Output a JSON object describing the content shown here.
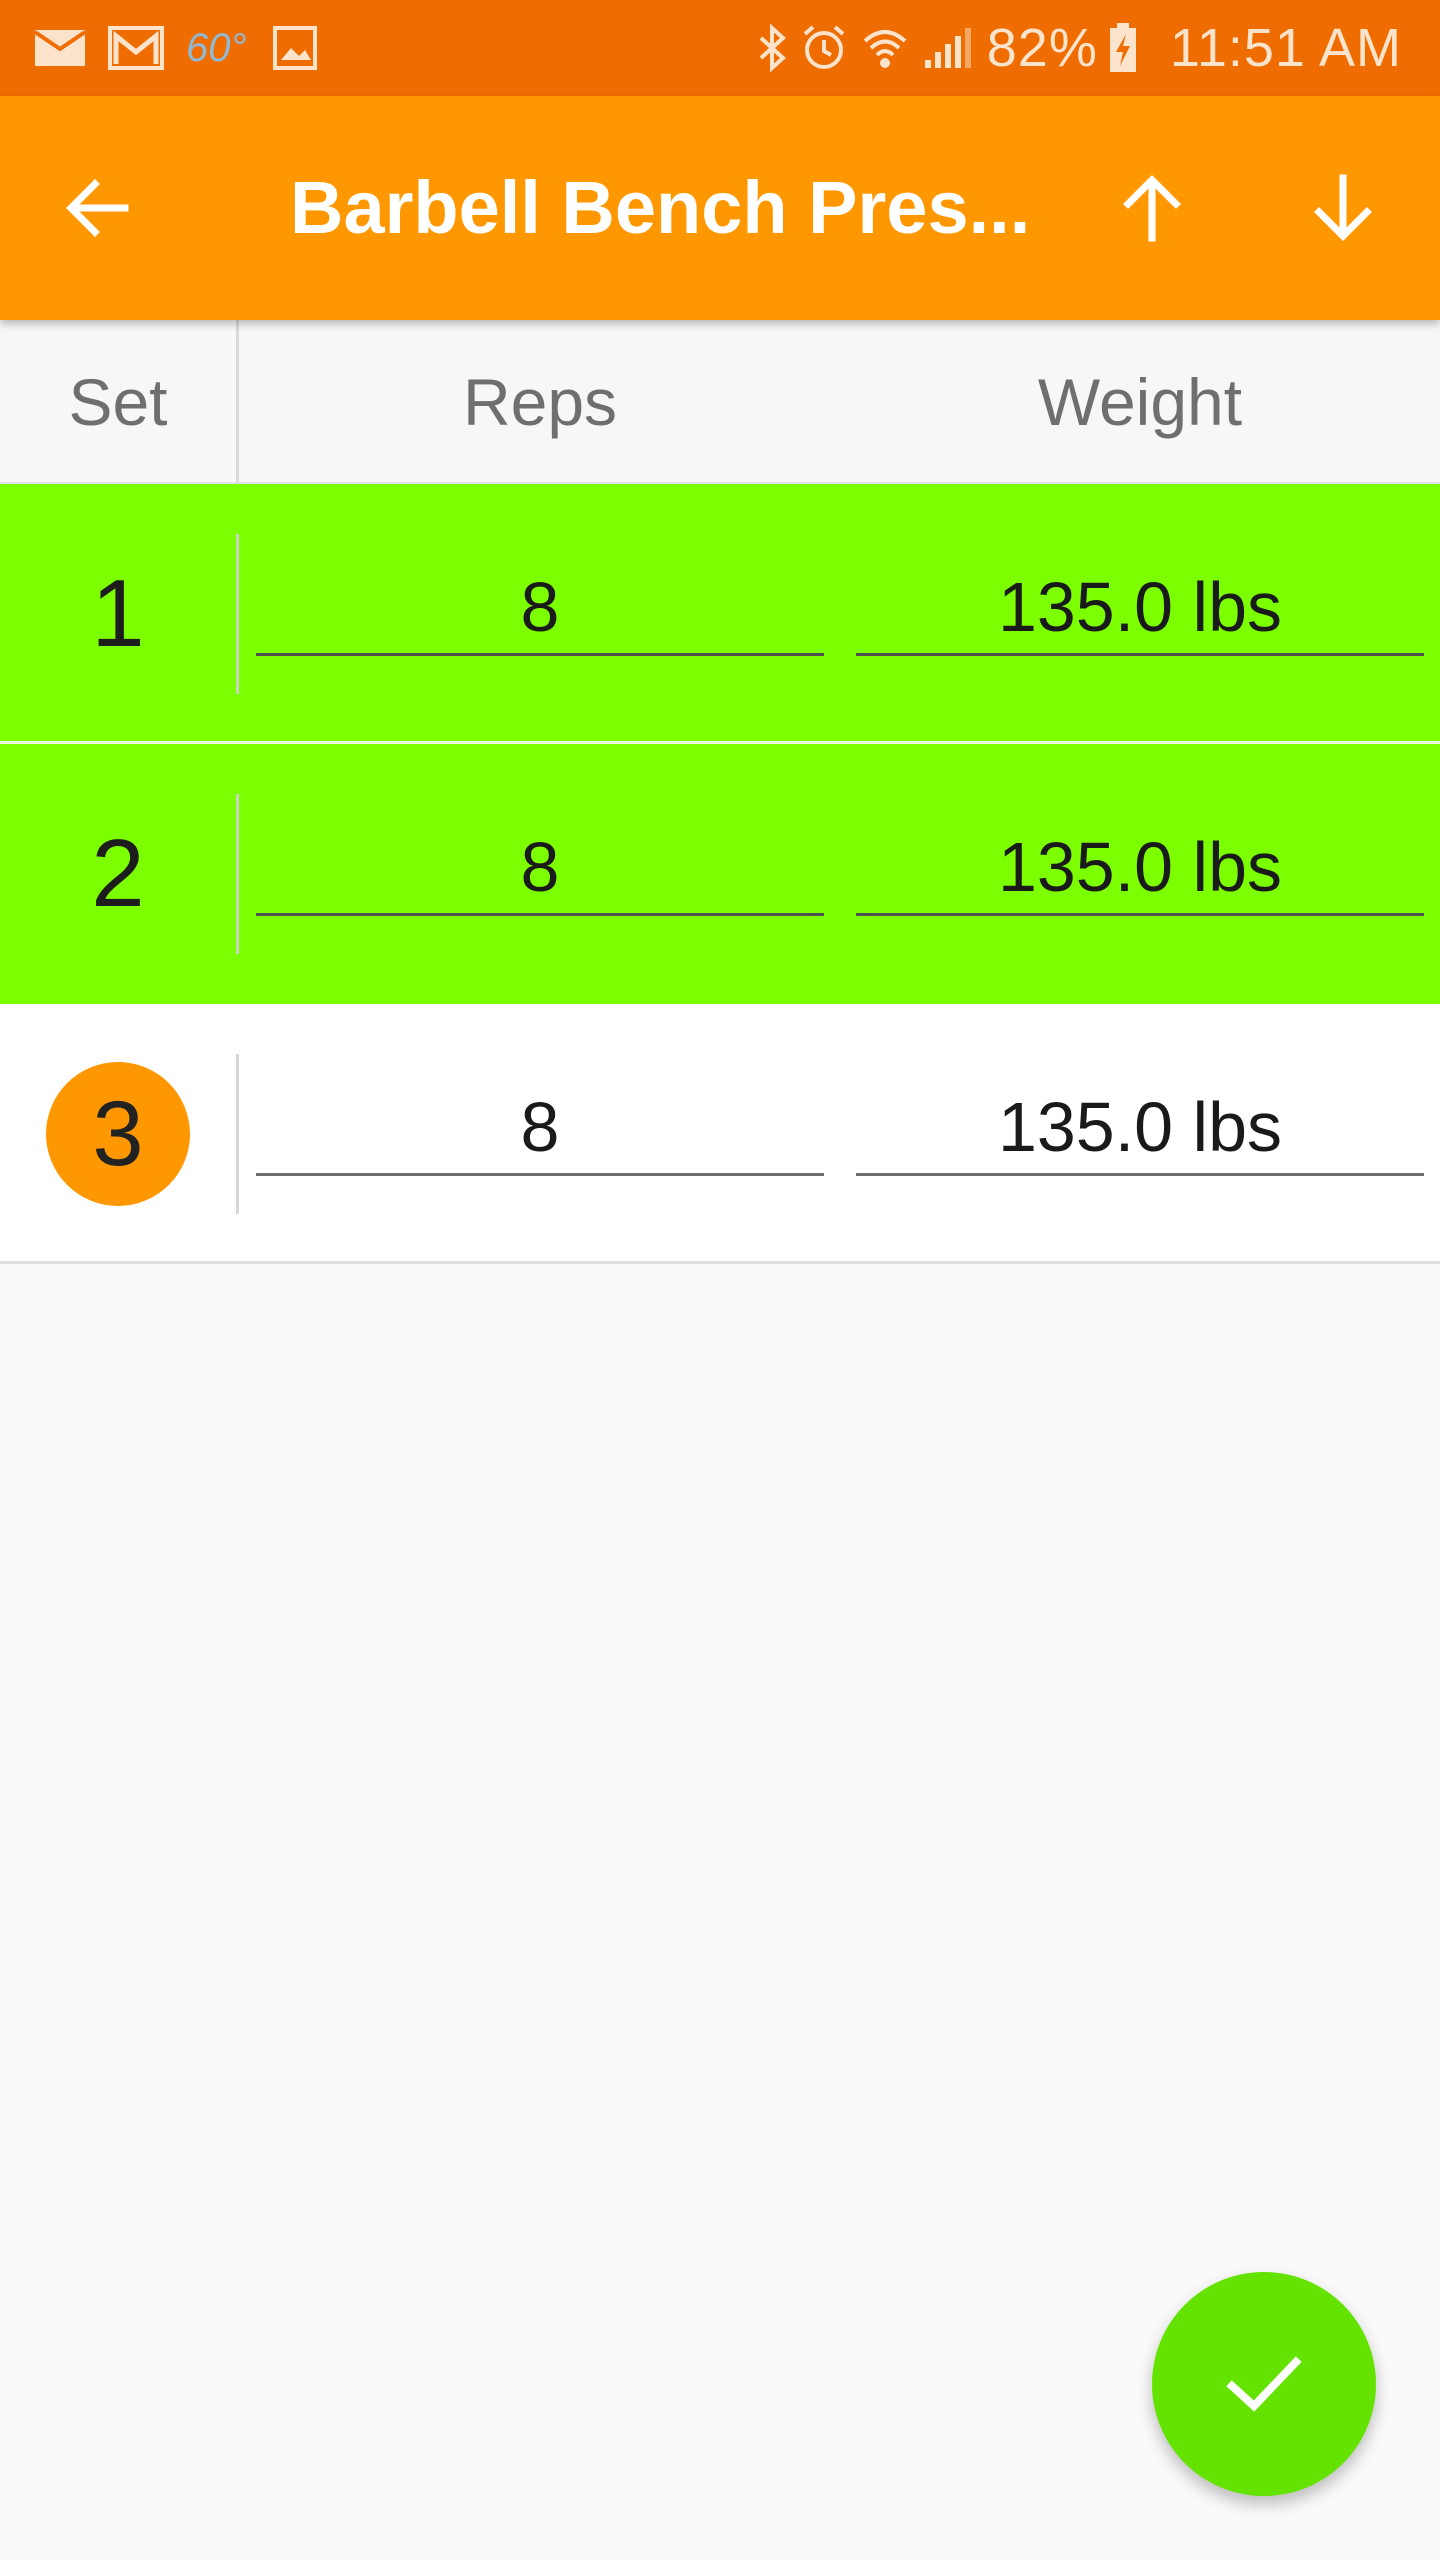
{
  "status_bar": {
    "weather": "60°",
    "battery_percent": "82%",
    "time": "11:51 AM",
    "left_icons": [
      "mail-icon",
      "gmail-icon",
      "gallery-icon"
    ],
    "right_icons": [
      "bluetooth-icon",
      "alarm-icon",
      "wifi-icon",
      "signal-icon",
      "battery-charging-icon"
    ]
  },
  "app_bar": {
    "title": "Barbell Bench Pres...",
    "back_icon": "arrow-back-icon",
    "up_icon": "arrow-up-icon",
    "down_icon": "arrow-down-icon"
  },
  "table": {
    "headers": {
      "set": "Set",
      "reps": "Reps",
      "weight": "Weight"
    },
    "rows": [
      {
        "set": "1",
        "reps": "8",
        "weight": "135.0 lbs",
        "state": "completed"
      },
      {
        "set": "2",
        "reps": "8",
        "weight": "135.0 lbs",
        "state": "completed"
      },
      {
        "set": "3",
        "reps": "8",
        "weight": "135.0 lbs",
        "state": "current"
      }
    ]
  },
  "fab": {
    "icon": "check-icon"
  },
  "colors": {
    "status_bar": "#ef6c00",
    "app_bar": "#ff9800",
    "completed_row": "#7cff00",
    "current_set_circle": "#ff9800",
    "fab": "#64e300"
  }
}
